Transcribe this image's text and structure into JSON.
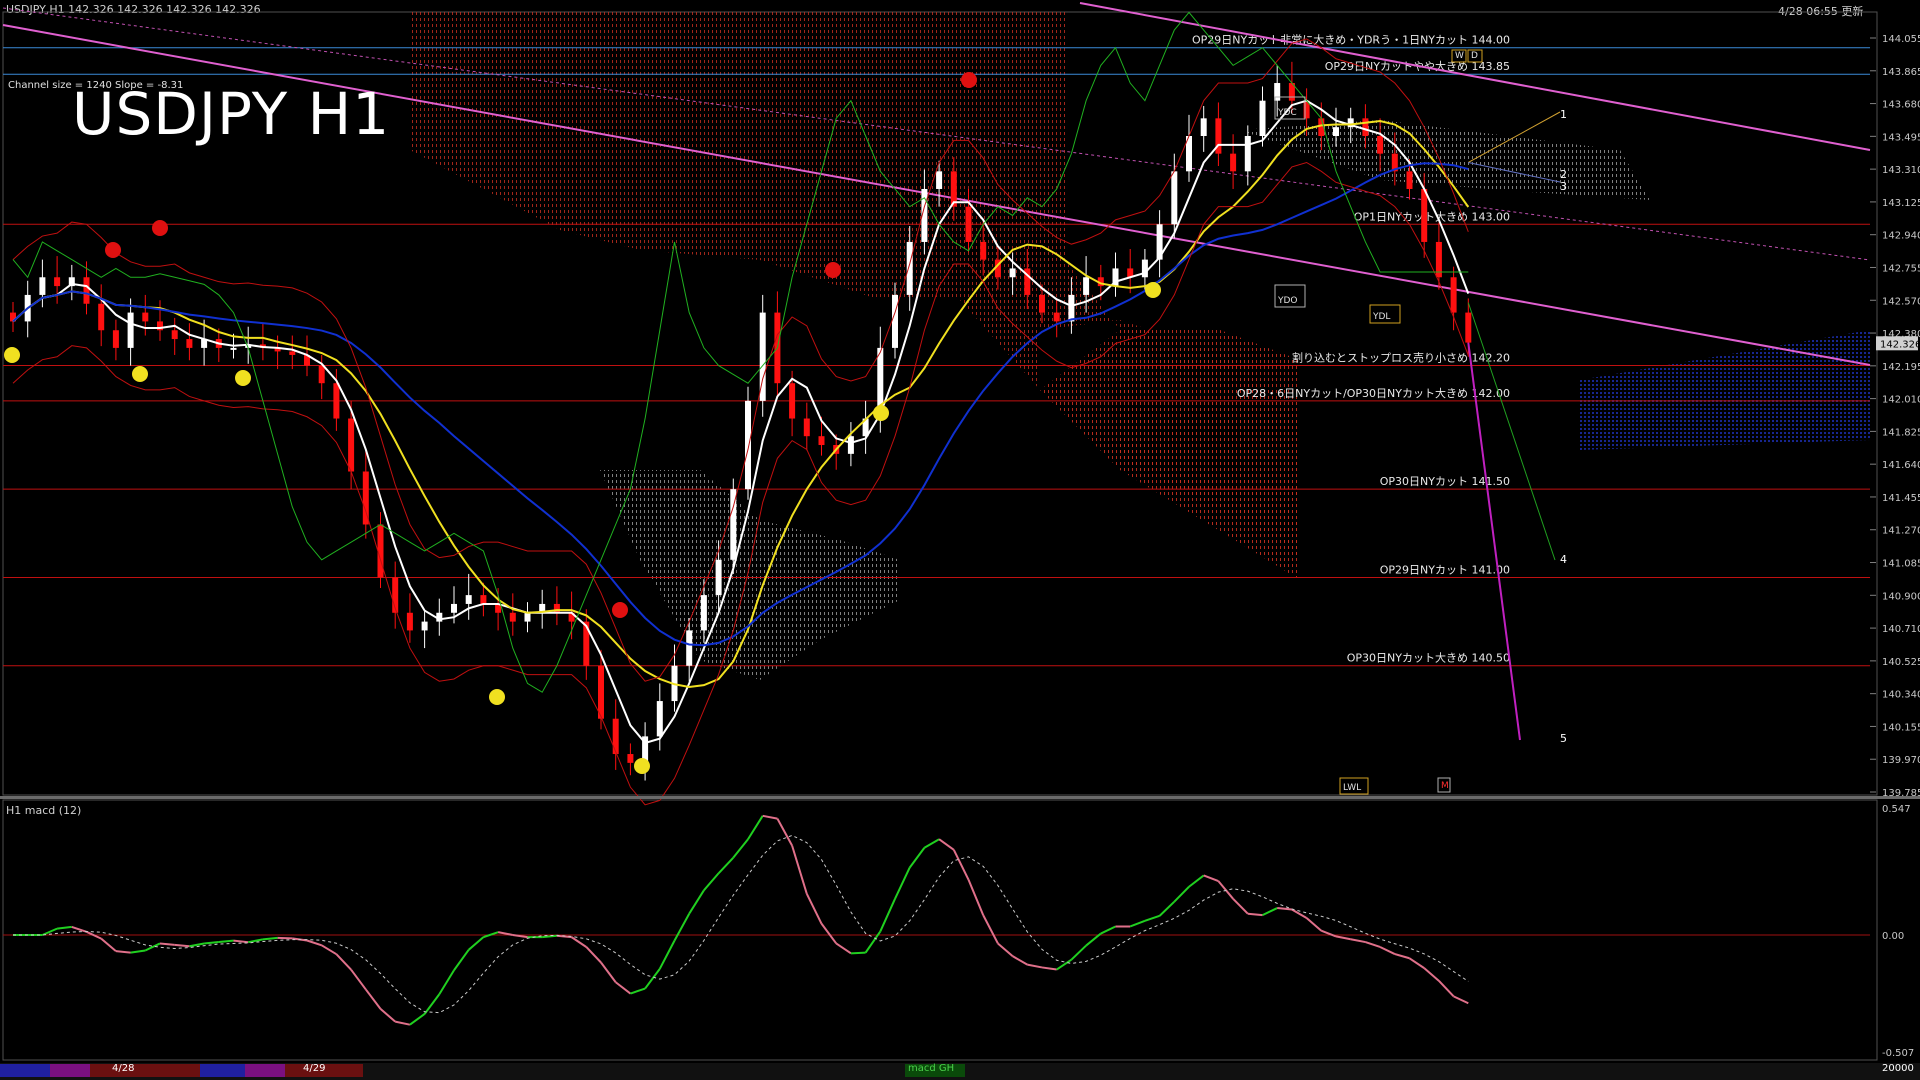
{
  "header": {
    "symbol_info": "USDJPY,H1  142.326 142.326 142.326 142.326",
    "timestamp": "4/28 06:55 更新"
  },
  "title": "USDJPY H1",
  "channel_info": "Channel size = 1240 Slope = -8.31",
  "price_axis": [
    "144.055",
    "143.865",
    "143.680",
    "143.495",
    "143.310",
    "143.125",
    "142.940",
    "142.755",
    "142.570",
    "142.380",
    "142.195",
    "142.010",
    "141.825",
    "141.640",
    "141.455",
    "141.270",
    "141.085",
    "140.900",
    "140.710",
    "140.525",
    "140.340",
    "140.155",
    "139.970",
    "139.785"
  ],
  "current_price": "142.326",
  "levels": [
    {
      "text": "OP29日NYカット非常に大きめ・YDRう・1日NYカット 144.00",
      "price": 144.0,
      "color": "#3a8ad8"
    },
    {
      "text": "OP29日NYカットやや大きめ 143.85",
      "price": 143.85,
      "color": "#3a8ad8"
    },
    {
      "text": "OP1日NYカット大きめ 143.00",
      "price": 143.0,
      "color": "#c01010"
    },
    {
      "text": "割り込むとストップロス売り小さめ 142.20",
      "price": 142.2,
      "color": "#c01010"
    },
    {
      "text": "OP28・6日NYカット/OP30日NYカット大きめ 142.00",
      "price": 142.0,
      "color": "#c01010"
    },
    {
      "text": "OP30日NYカット 141.50",
      "price": 141.5,
      "color": "#c01010"
    },
    {
      "text": "OP29日NYカット 141.00",
      "price": 141.0,
      "color": "#c01010"
    },
    {
      "text": "OP30日NYカット大きめ 140.50",
      "price": 140.5,
      "color": "#c01010"
    }
  ],
  "wave_labels": [
    "1",
    "2",
    "3",
    "4",
    "5"
  ],
  "box_labels": [
    "YDC",
    "YDO",
    "YDL",
    "LWL",
    "W",
    "D",
    "M"
  ],
  "macd": {
    "label": "H1  macd (12)",
    "axis": [
      "0.547",
      "0.00",
      "-0.507"
    ]
  },
  "bottom_bar": {
    "dates": [
      "4/28",
      "4/29"
    ],
    "tab": "macd GH",
    "right_value": "20000"
  },
  "colors": {
    "bull": "#ffffff",
    "bear": "#ff1010",
    "sma_short": "#ffffff",
    "sma_mid": "#f0e020",
    "sma_long": "#1030d0",
    "bollinger": "#c01010",
    "chikou": "#20b020",
    "channel": "#e060d0",
    "macd_up": "#20d020",
    "macd_down": "#e0708a",
    "signal": "#cccccc"
  },
  "chart_data": {
    "type": "line",
    "title": "USDJPY H1",
    "xlabel": "",
    "ylabel": "",
    "ylim": [
      139.785,
      144.055
    ],
    "x": [
      1,
      2,
      3,
      4,
      5,
      6,
      7,
      8,
      9,
      10,
      11,
      12,
      13,
      14,
      15,
      16,
      17,
      18,
      19,
      20,
      21,
      22,
      23,
      24,
      25,
      26,
      27,
      28,
      29,
      30,
      31,
      32,
      33,
      34,
      35,
      36,
      37,
      38,
      39,
      40,
      41,
      42,
      43,
      44,
      45,
      46,
      47,
      48,
      49,
      50,
      51,
      52,
      53,
      54,
      55,
      56,
      57,
      58,
      59,
      60,
      61,
      62,
      63,
      64,
      65,
      66,
      67,
      68,
      69,
      70,
      71,
      72,
      73,
      74,
      75,
      76,
      77,
      78,
      79,
      80,
      81,
      82,
      83,
      84,
      85,
      86,
      87,
      88,
      89,
      90,
      91,
      92,
      93,
      94,
      95,
      96,
      97,
      98,
      99,
      100
    ],
    "series": [
      {
        "name": "",
        "values": [
          142.45,
          142.6,
          142.7,
          142.65,
          142.7,
          142.55,
          142.4,
          142.3,
          142.5,
          142.45,
          142.4,
          142.35,
          142.3,
          142.35,
          142.3,
          142.3,
          142.32,
          142.3,
          142.28,
          142.26,
          142.2,
          142.1,
          141.9,
          141.6,
          141.3,
          141.0,
          140.8,
          140.7,
          140.75,
          140.8,
          140.85,
          140.9,
          140.85,
          140.8,
          140.75,
          140.8,
          140.85,
          140.8,
          140.75,
          140.5,
          140.2,
          140.0,
          139.95,
          140.1,
          140.3,
          140.5,
          140.7,
          140.9,
          141.1,
          141.5,
          142.0,
          142.5,
          142.1,
          141.9,
          141.8,
          141.75,
          141.7,
          141.8,
          141.9,
          142.3,
          142.6,
          142.9,
          143.2,
          143.3,
          143.1,
          142.9,
          142.8,
          142.7,
          142.75,
          142.6,
          142.5,
          142.45,
          142.6,
          142.7,
          142.65,
          142.75,
          142.7,
          142.8,
          143.0,
          143.3,
          143.5,
          143.6,
          143.4,
          143.3,
          143.5,
          143.7,
          143.8,
          143.7,
          143.6,
          143.5,
          143.55,
          143.6,
          143.5,
          143.4,
          143.3,
          143.2,
          142.9,
          142.7,
          142.5,
          142.33
        ]
      }
    ]
  }
}
